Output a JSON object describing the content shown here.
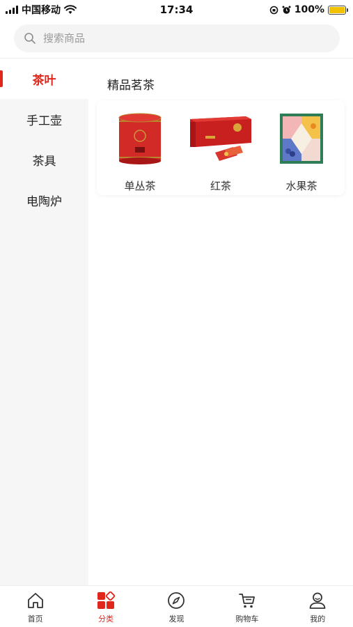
{
  "status_bar": {
    "carrier": "中国移动",
    "time": "17:34",
    "battery": "100%",
    "icons": [
      "signal-icon",
      "wifi-icon",
      "orientation-lock-icon",
      "alarm-icon",
      "battery-charging-icon"
    ]
  },
  "search": {
    "placeholder": "搜索商品",
    "icon": "search-icon"
  },
  "sidebar": {
    "items": [
      {
        "label": "茶叶",
        "active": true
      },
      {
        "label": "手工壶",
        "active": false
      },
      {
        "label": "茶具",
        "active": false
      },
      {
        "label": "电陶炉",
        "active": false
      }
    ]
  },
  "content": {
    "section_title": "精品茗茶",
    "products": [
      {
        "name": "单丛茶",
        "image": "red-tea-can"
      },
      {
        "name": "红茶",
        "image": "red-gift-box"
      },
      {
        "name": "水果茶",
        "image": "fruit-tea-box"
      }
    ]
  },
  "tabbar": {
    "items": [
      {
        "label": "首页",
        "icon": "home-icon",
        "active": false
      },
      {
        "label": "分类",
        "icon": "category-icon",
        "active": true
      },
      {
        "label": "发现",
        "icon": "compass-icon",
        "active": false
      },
      {
        "label": "购物车",
        "icon": "cart-icon",
        "active": false
      },
      {
        "label": "我的",
        "icon": "user-icon",
        "active": false
      }
    ]
  },
  "colors": {
    "accent": "#e0261b",
    "sidebar_bg": "#f6f6f6",
    "search_bg": "#f4f4f4"
  }
}
